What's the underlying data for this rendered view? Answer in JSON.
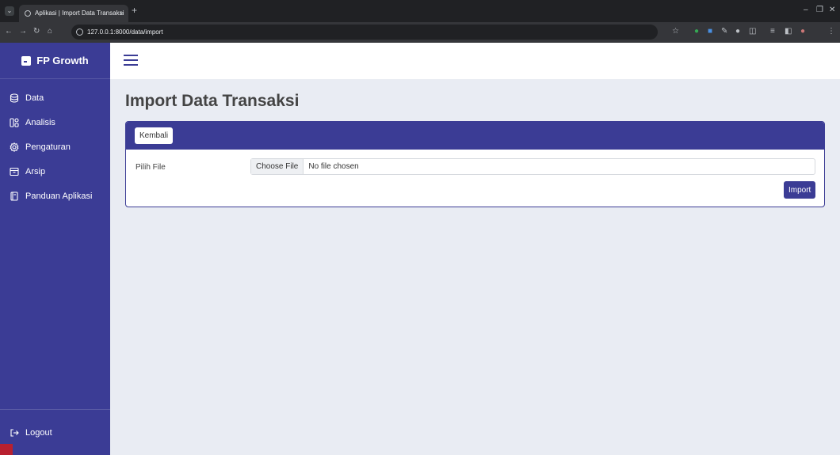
{
  "browser": {
    "tab_title": "Aplikasi | Import Data Transaksi",
    "tab_close": "×",
    "new_tab": "+",
    "url": "127.0.0.1:8000/data/import"
  },
  "sidebar": {
    "brand": "FP Growth",
    "items": [
      {
        "label": "Data",
        "icon": "database-icon"
      },
      {
        "label": "Analisis",
        "icon": "grid-icon"
      },
      {
        "label": "Pengaturan",
        "icon": "gear-icon"
      },
      {
        "label": "Arsip",
        "icon": "archive-icon"
      },
      {
        "label": "Panduan Aplikasi",
        "icon": "book-icon"
      }
    ],
    "logout": "Logout"
  },
  "main": {
    "title": "Import Data Transaksi",
    "back_button": "Kembali",
    "file_label": "Pilih File",
    "choose_file": "Choose File",
    "no_file": "No file chosen",
    "import_button": "Import"
  },
  "colors": {
    "primary": "#3b3c95",
    "background": "#e9ecf3"
  }
}
